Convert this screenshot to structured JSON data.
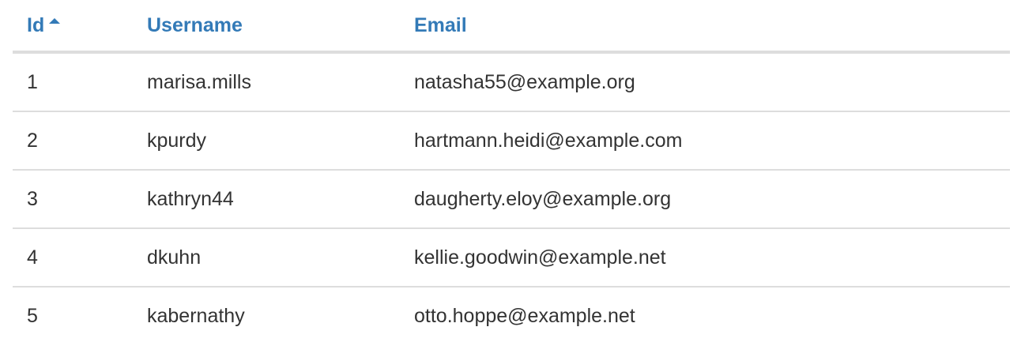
{
  "table": {
    "columns": [
      {
        "key": "id",
        "label": "Id",
        "sorted": "ascending",
        "sort_icon": "caret-up-icon"
      },
      {
        "key": "username",
        "label": "Username"
      },
      {
        "key": "email",
        "label": "Email"
      }
    ],
    "rows": [
      {
        "id": "1",
        "username": "marisa.mills",
        "email": "natasha55@example.org"
      },
      {
        "id": "2",
        "username": "kpurdy",
        "email": "hartmann.heidi@example.com"
      },
      {
        "id": "3",
        "username": "kathryn44",
        "email": "daugherty.eloy@example.org"
      },
      {
        "id": "4",
        "username": "dkuhn",
        "email": "kellie.goodwin@example.net"
      },
      {
        "id": "5",
        "username": "kabernathy",
        "email": "otto.hoppe@example.net"
      }
    ]
  },
  "colors": {
    "header_link": "#337ab7",
    "text": "#333333",
    "border": "#dddddd"
  }
}
